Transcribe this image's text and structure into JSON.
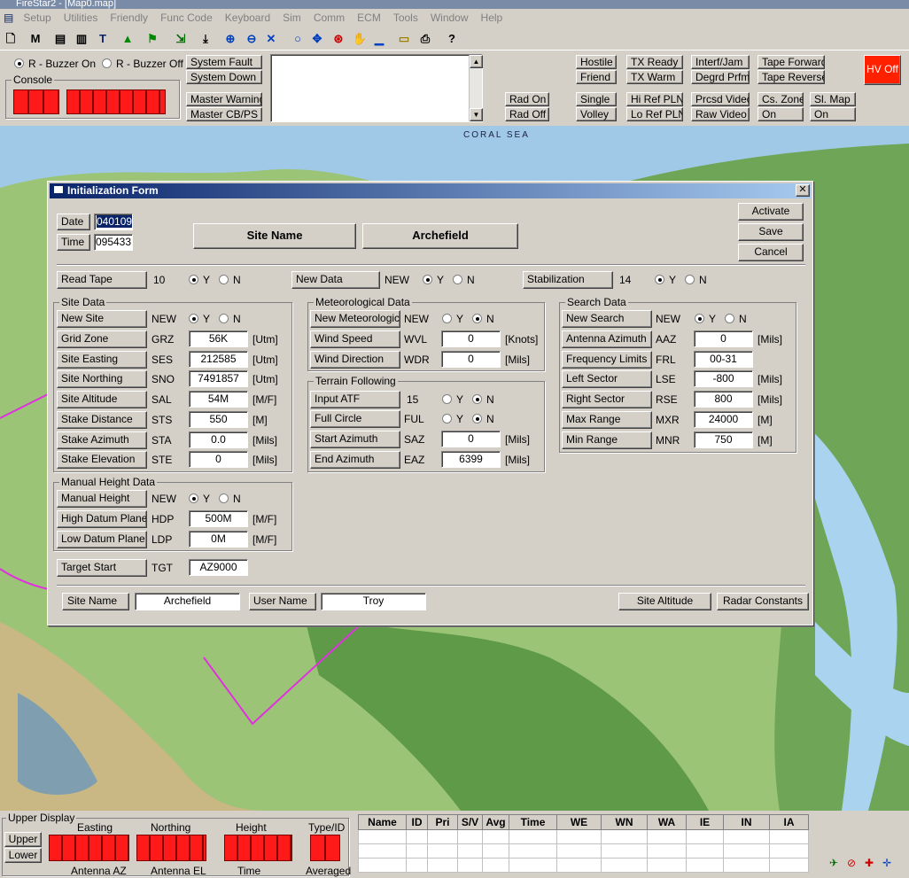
{
  "window": {
    "title": "FireStar2 - [Map0.map]"
  },
  "menu": [
    "Setup",
    "Utilities",
    "Friendly",
    "Func Code",
    "Keyboard",
    "Sim",
    "Comm",
    "ECM",
    "Tools",
    "Window",
    "Help"
  ],
  "controls": {
    "buzzer_on": "R - Buzzer On",
    "buzzer_off": "R - Buzzer Off",
    "console": "Console",
    "system_fault": "System Fault",
    "system_down": "System Down",
    "master_warning": "Master Warning",
    "master_cb": "Master CB/PS",
    "rad_on": "Rad On",
    "rad_off": "Rad Off",
    "hostile": "Hostile",
    "friend": "Friend",
    "single": "Single",
    "volley": "Volley",
    "tx_ready": "TX Ready",
    "tx_warm": "TX Warm",
    "hi_ref": "Hi Ref PLN",
    "lo_ref": "Lo Ref PLN",
    "interf": "Interf/Jam",
    "degrd": "Degrd Prfm",
    "prcsd": "Prcsd Video",
    "raw": "Raw Video",
    "tape_fwd": "Tape Forward",
    "tape_rev": "Tape Reverse",
    "cs_zone": "Cs. Zone",
    "cs_on": "On",
    "sl_map": "Sl. Map",
    "sl_on": "On",
    "hv_off": "HV Off"
  },
  "map": {
    "label": "CORAL SEA"
  },
  "dialog": {
    "title": "Initialization Form",
    "date_label": "Date",
    "date_value": "040109",
    "time_label": "Time",
    "time_value": "095433",
    "site_name_label": "Site Name",
    "site_name_value": "Archefield",
    "activate": "Activate",
    "save": "Save",
    "cancel": "Cancel",
    "read_tape": {
      "label": "Read Tape",
      "code": "10",
      "sel": "Y"
    },
    "new_data": {
      "label": "New Data",
      "code": "NEW",
      "sel": "Y"
    },
    "stabilization": {
      "label": "Stabilization",
      "code": "14",
      "sel": "Y"
    },
    "y": "Y",
    "n": "N",
    "site_data": {
      "title": "Site Data",
      "rows": [
        {
          "label": "New Site",
          "code": "NEW",
          "radio": "Y"
        },
        {
          "label": "Grid Zone",
          "code": "GRZ",
          "value": "56K",
          "unit": "[Utm]"
        },
        {
          "label": "Site Easting",
          "code": "SES",
          "value": "212585",
          "unit": "[Utm]"
        },
        {
          "label": "Site Northing",
          "code": "SNO",
          "value": "7491857",
          "unit": "[Utm]"
        },
        {
          "label": "Site Altitude",
          "code": "SAL",
          "value": "54M",
          "unit": "[M/F]"
        },
        {
          "label": "Stake Distance",
          "code": "STS",
          "value": "550",
          "unit": "[M]"
        },
        {
          "label": "Stake Azimuth",
          "code": "STA",
          "value": "0.0",
          "unit": "[Mils]"
        },
        {
          "label": "Stake Elevation",
          "code": "STE",
          "value": "0",
          "unit": "[Mils]"
        }
      ]
    },
    "manual_height": {
      "title": "Manual Height Data",
      "rows": [
        {
          "label": "Manual Height",
          "code": "NEW",
          "radio": "Y"
        },
        {
          "label": "High Datum Plane",
          "code": "HDP",
          "value": "500M",
          "unit": "[M/F]"
        },
        {
          "label": "Low Datum Plane",
          "code": "LDP",
          "value": "0M",
          "unit": "[M/F]"
        }
      ]
    },
    "target_start": {
      "label": "Target Start",
      "code": "TGT",
      "value": "AZ9000"
    },
    "met_data": {
      "title": "Meteorological Data",
      "rows": [
        {
          "label": "New Meteorological",
          "code": "NEW",
          "radio": "N"
        },
        {
          "label": "Wind Speed",
          "code": "WVL",
          "value": "0",
          "unit": "[Knots]"
        },
        {
          "label": "Wind Direction",
          "code": "WDR",
          "value": "0",
          "unit": "[Mils]"
        }
      ]
    },
    "terrain": {
      "title": "Terrain Following",
      "rows": [
        {
          "label": "Input ATF",
          "code": "15",
          "radio": "N"
        },
        {
          "label": "Full Circle",
          "code": "FUL",
          "radio": "N"
        },
        {
          "label": "Start Azimuth",
          "code": "SAZ",
          "value": "0",
          "unit": "[Mils]"
        },
        {
          "label": "End Azimuth",
          "code": "EAZ",
          "value": "6399",
          "unit": "[Mils]"
        }
      ]
    },
    "search": {
      "title": "Search Data",
      "rows": [
        {
          "label": "New Search",
          "code": "NEW",
          "radio": "Y"
        },
        {
          "label": "Antenna Azimuth",
          "code": "AAZ",
          "value": "0",
          "unit": "[Mils]"
        },
        {
          "label": "Frequency Limits",
          "code": "FRL",
          "value": "00-31",
          "unit": ""
        },
        {
          "label": "Left Sector",
          "code": "LSE",
          "value": "-800",
          "unit": "[Mils]"
        },
        {
          "label": "Right Sector",
          "code": "RSE",
          "value": "800",
          "unit": "[Mils]"
        },
        {
          "label": "Max Range",
          "code": "MXR",
          "value": "24000",
          "unit": "[M]"
        },
        {
          "label": "Min Range",
          "code": "MNR",
          "value": "750",
          "unit": "[M]"
        }
      ]
    },
    "footer": {
      "site_name_label": "Site Name",
      "site_name_value": "Archefield",
      "user_name_label": "User Name",
      "user_name_value": "Troy",
      "site_altitude": "Site Altitude",
      "radar_constants": "Radar Constants"
    }
  },
  "bottom": {
    "upper_display": "Upper Display",
    "upper": "Upper",
    "lower": "Lower",
    "easting": "Easting",
    "northing": "Northing",
    "height": "Height",
    "type_id": "Type/ID",
    "antenna_az": "Antenna AZ",
    "antenna_el": "Antenna EL",
    "time": "Time",
    "averaged": "Averaged",
    "columns": [
      "Name",
      "ID",
      "Pri",
      "S/V",
      "Avg",
      "Time",
      "WE",
      "WN",
      "WA",
      "IE",
      "IN",
      "IA"
    ]
  }
}
